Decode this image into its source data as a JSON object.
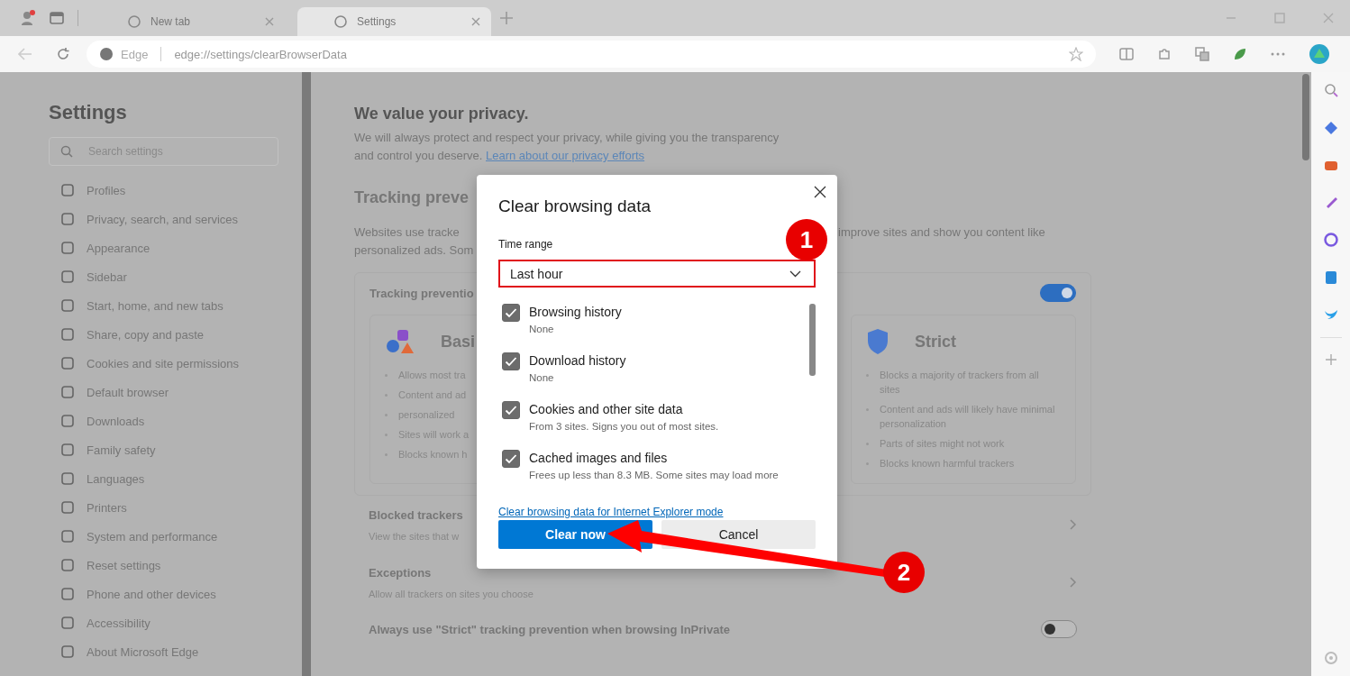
{
  "tabs": [
    {
      "title": "New tab",
      "selected": false
    },
    {
      "title": "Settings",
      "selected": true
    }
  ],
  "address_bar": {
    "site": "Edge",
    "url": "edge://settings/clearBrowserData"
  },
  "sidebar": {
    "title": "Settings",
    "search_placeholder": "Search settings",
    "items": [
      "Profiles",
      "Privacy, search, and services",
      "Appearance",
      "Sidebar",
      "Start, home, and new tabs",
      "Share, copy and paste",
      "Cookies and site permissions",
      "Default browser",
      "Downloads",
      "Family safety",
      "Languages",
      "Printers",
      "System and performance",
      "Reset settings",
      "Phone and other devices",
      "Accessibility",
      "About Microsoft Edge"
    ]
  },
  "main": {
    "heading": "We value your privacy.",
    "intro_line_1": "We will always protect and respect your privacy, while giving you the transparency",
    "intro_line_2": "and control you deserve.",
    "intro_link": "Learn about our privacy efforts",
    "section_title": "Tracking preve",
    "description_left_1": "Websites use tracke",
    "description_right_1": "improve sites and show you content like",
    "description_left_2": "personalized ads. Som",
    "card_title": "Tracking preventio",
    "tracking_on": true,
    "levels": [
      {
        "title": "Basi",
        "bullets": [
          "Allows most tra",
          "Content and ad",
          "personalized",
          "Sites will work a",
          "Blocks known h"
        ]
      },
      {
        "title": "Strict",
        "bullets": [
          "Blocks a majority of trackers from all sites",
          "Content and ads will likely have minimal personalization",
          "Parts of sites might not work",
          "Blocks known harmful trackers"
        ]
      }
    ],
    "rows": [
      {
        "title": "Blocked trackers",
        "subtitle": "View the sites that w"
      },
      {
        "title": "Exceptions",
        "subtitle": "Allow all trackers on sites you choose"
      }
    ],
    "inprivate_label": "Always use \"Strict\" tracking prevention when browsing InPrivate",
    "inprivate_on": false
  },
  "dialog": {
    "title": "Clear browsing data",
    "time_range_label": "Time range",
    "time_range_value": "Last hour",
    "items": [
      {
        "label": "Browsing history",
        "detail": "None",
        "checked": true
      },
      {
        "label": "Download history",
        "detail": "None",
        "checked": true
      },
      {
        "label": "Cookies and other site data",
        "detail": "From 3 sites. Signs you out of most sites.",
        "checked": true
      },
      {
        "label": "Cached images and files",
        "detail": "Frees up less than 8.3 MB. Some sites may load more",
        "checked": true
      }
    ],
    "ie_link": "Clear browsing data for Internet Explorer mode",
    "primary_button": "Clear now",
    "secondary_button": "Cancel"
  },
  "annotations": [
    {
      "label": "1"
    },
    {
      "label": "2"
    }
  ]
}
